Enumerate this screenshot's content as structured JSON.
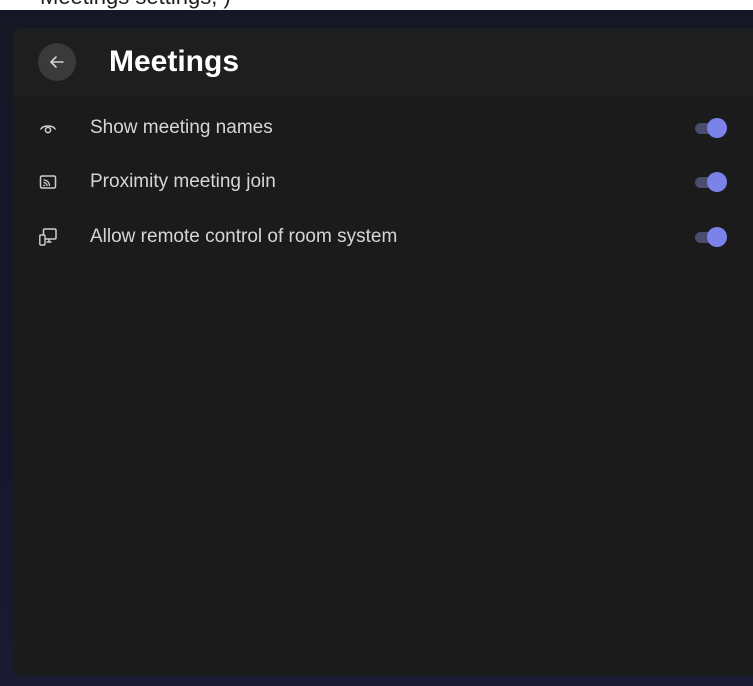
{
  "window": {
    "caption_fragment": "Meetings settings, )"
  },
  "header": {
    "back_label": "Back",
    "title": "Meetings"
  },
  "settings": [
    {
      "label": "Show meeting names",
      "icon": "eye-icon",
      "enabled": true
    },
    {
      "label": "Proximity meeting join",
      "icon": "cast-icon",
      "enabled": true
    },
    {
      "label": "Allow remote control of room system",
      "icon": "remote-device-icon",
      "enabled": true
    }
  ],
  "colors": {
    "accent": "#7b83eb",
    "panel": "#1b1b1b",
    "header": "#1e1e1e",
    "backdrop": "#15162a"
  }
}
